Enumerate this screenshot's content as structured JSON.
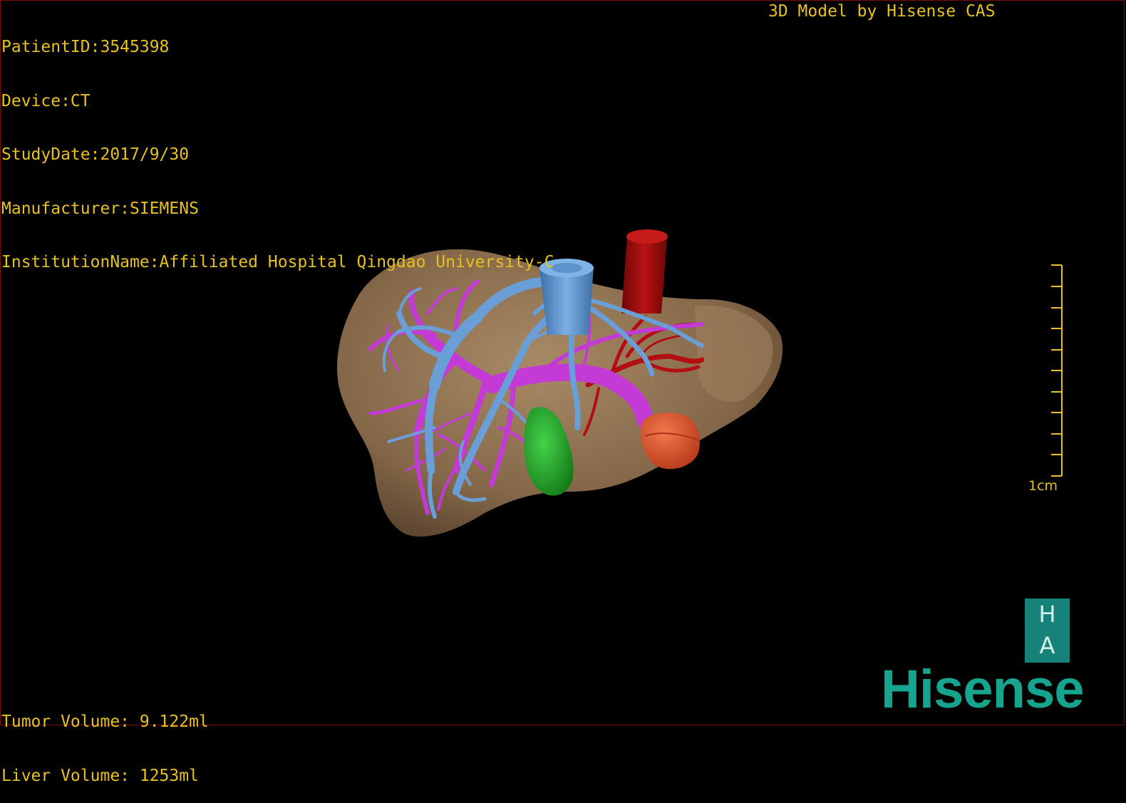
{
  "header": {
    "patient_id": "PatientID:3545398",
    "device": "Device:CT",
    "study_date": "StudyDate:2017/9/30",
    "manufacturer": "Manufacturer:SIEMENS",
    "institution": "InstitutionName:Affiliated Hospital Qingdao University-C"
  },
  "credit": "3D Model by Hisense CAS",
  "volumes": {
    "tumor": "Tumor Volume: 9.122ml",
    "liver": "Liver Volume: 1253ml"
  },
  "scale_bar": {
    "label": "1cm"
  },
  "logo": {
    "badge_top": "H",
    "badge_bottom": "A",
    "brand": "Hisense"
  },
  "colors": {
    "text": "#e6c21e",
    "liver": "#8a6d4e",
    "hepatic_vein": "#5b93cf",
    "portal_vein": "#c43ad6",
    "artery_ivc": "#a10d0d",
    "gallbladder": "#27a82c",
    "tumor": "#e0582f",
    "brand": "#16a48f"
  }
}
